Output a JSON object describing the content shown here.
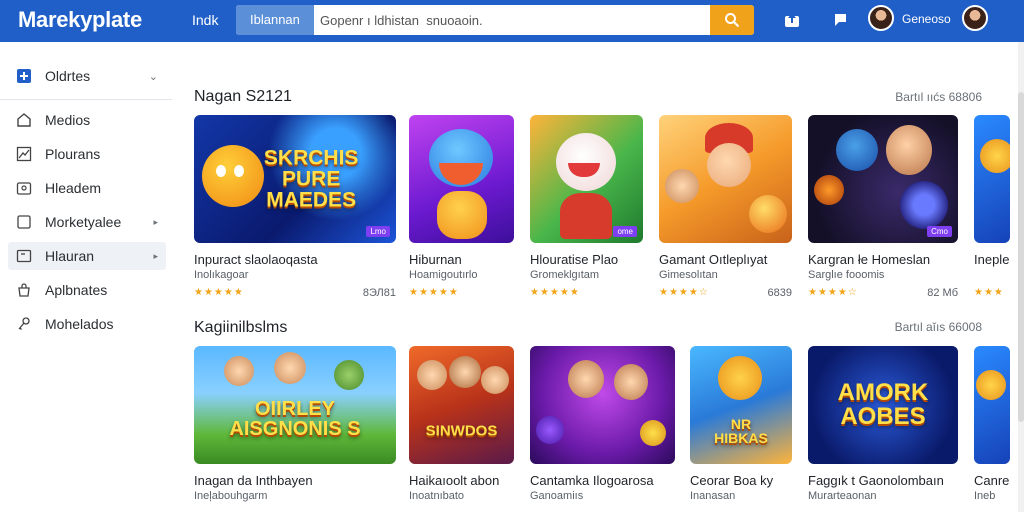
{
  "header": {
    "brand": "Marekyplate",
    "link": "Indk",
    "search_category": "Iblannan",
    "search_placeholder": "Gopenr ı ldhistan  snuoaoin.",
    "user_name": "Geneoso"
  },
  "sidebar": {
    "items": [
      {
        "label": "Oldrtes",
        "icon": "plus-square-icon"
      },
      {
        "label": "Medios",
        "icon": "home-icon"
      },
      {
        "label": "Plourans",
        "icon": "chart-icon"
      },
      {
        "label": "Hleadem",
        "icon": "people-icon"
      },
      {
        "label": "Morketyalee",
        "icon": "square-icon"
      },
      {
        "label": "Hlauran",
        "icon": "box-icon"
      },
      {
        "label": "Aplbnates",
        "icon": "bag-icon"
      },
      {
        "label": "Mohelados",
        "icon": "key-icon"
      }
    ]
  },
  "sections": [
    {
      "title": "Nagan S2121",
      "more": "Bartıl ııćs 68806",
      "cards": [
        {
          "title": "Inpuract slaolaoqasta",
          "sub": "Inolıkagoar",
          "rating": "★★★★★",
          "price": "8ЭЛ81",
          "art": "Skrchis\nPure\nMaedes",
          "chip": "Lmo"
        },
        {
          "title": "Hiburnan",
          "sub": "Hoamigoutırlo",
          "rating": "★★★★★",
          "price": "",
          "art": "",
          "chip": ""
        },
        {
          "title": "Hlouratise Plao",
          "sub": "Gromeklgıtam",
          "rating": "★★★★★",
          "price": "",
          "art": "",
          "chip": "ome"
        },
        {
          "title": "Gamant Oıtleplıyat",
          "sub": "Gimesolıtan",
          "rating": "★★★★☆",
          "price": "6839",
          "art": "",
          "chip": ""
        },
        {
          "title": "Kargran łe Homeslan",
          "sub": "Sarglıe fooomis",
          "rating": "★★★★☆",
          "price": "82 Mб",
          "art": "",
          "chip": "Cmo"
        },
        {
          "title": "Ineple",
          "sub": "",
          "rating": "★★★",
          "price": "",
          "art": "",
          "chip": ""
        }
      ]
    },
    {
      "title": "Kagiinilbslms",
      "more": "Bartıl aĭıs 66008",
      "cards": [
        {
          "title": "Inagan da Inthbayen",
          "sub": "Ineļabouhgarm",
          "rating": "",
          "price": "",
          "art": "Oıırley\nAisgnonis S",
          "chip": ""
        },
        {
          "title": "Haikaıoolt abon",
          "sub": "Inoatnıbato",
          "rating": "",
          "price": "",
          "art": "Sinwdos",
          "chip": ""
        },
        {
          "title": "Cantamka Ilogoarosa",
          "sub": "Ganoamiıs",
          "rating": "",
          "price": "",
          "art": "",
          "chip": ""
        },
        {
          "title": "Ceorar Boa ky",
          "sub": "Inanasan",
          "rating": "",
          "price": "",
          "art": "Nr\nHibkas",
          "chip": ""
        },
        {
          "title": "Faggık t Gaonolombaın",
          "sub": "Murarteaonan",
          "rating": "",
          "price": "",
          "art": "Amork\nAobes",
          "chip": ""
        },
        {
          "title": "Canre",
          "sub": "Ineb",
          "rating": "",
          "price": "",
          "art": "",
          "chip": ""
        }
      ]
    }
  ],
  "colors": {
    "header_bg": "#1f5fc7",
    "search_button": "#f0a21b",
    "star": "#f2a51b",
    "chip": "#7e3ff2"
  }
}
